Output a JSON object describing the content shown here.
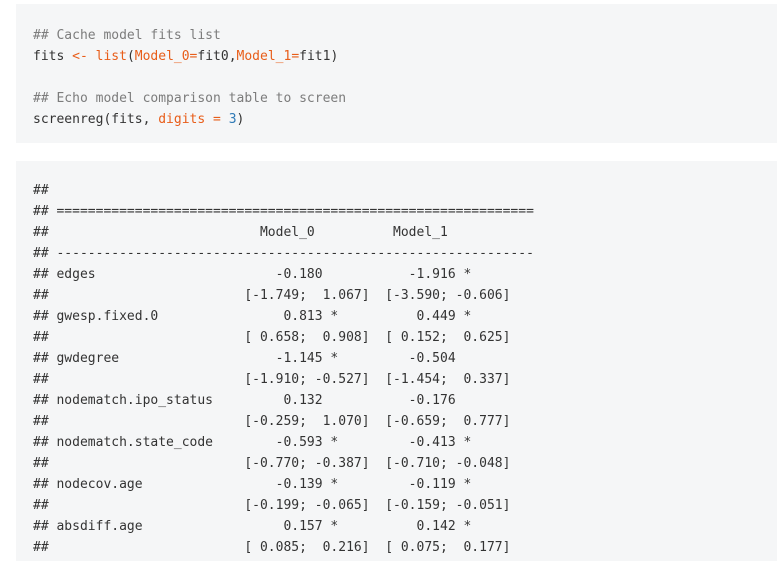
{
  "code": {
    "comment1": "## Cache model fits list",
    "line2": {
      "a": "fits ",
      "b": "<-",
      "c": " ",
      "d": "list",
      "e": "(",
      "f": "Model_0=",
      "g": "fit0,",
      "h": "Model_1=",
      "i": "fit1)"
    },
    "comment2": "## Echo model comparison table to screen",
    "line5": {
      "a": "screenreg(fits, ",
      "b": "digits",
      "c": " ",
      "d": "=",
      "e": " ",
      "f": "3",
      "g": ")"
    }
  },
  "output": {
    "lines": [
      "##",
      "## =============================================================",
      "##                           Model_0          Model_1",
      "## -------------------------------------------------------------",
      "## edges                       -0.180           -1.916 *",
      "##                         [-1.749;  1.067]  [-3.590; -0.606]",
      "## gwesp.fixed.0                0.813 *          0.449 *",
      "##                         [ 0.658;  0.908]  [ 0.152;  0.625]",
      "## gwdegree                    -1.145 *         -0.504",
      "##                         [-1.910; -0.527]  [-1.454;  0.337]",
      "## nodematch.ipo_status         0.132           -0.176",
      "##                         [-0.259;  1.070]  [-0.659;  0.777]",
      "## nodematch.state_code        -0.593 *         -0.413 *",
      "##                         [-0.770; -0.387]  [-0.710; -0.048]",
      "## nodecov.age                 -0.139 *         -0.119 *",
      "##                         [-0.199; -0.065]  [-0.159; -0.051]",
      "## absdiff.age                  0.157 *          0.142 *",
      "##                         [ 0.085;  0.216]  [ 0.075;  0.177]"
    ]
  }
}
